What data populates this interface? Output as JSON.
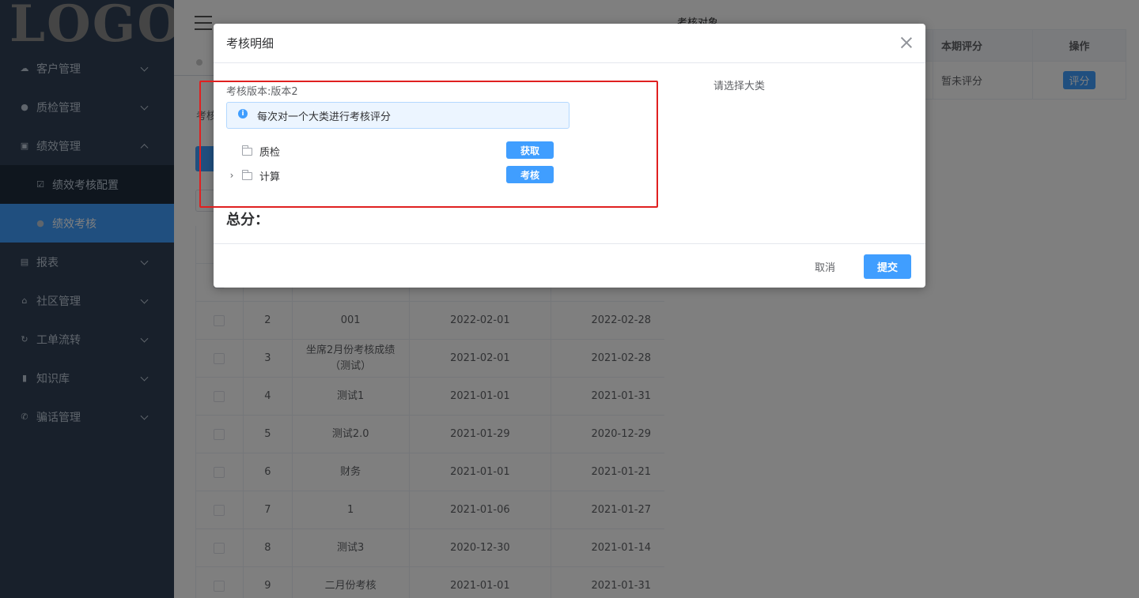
{
  "logo": "LOGO",
  "sidebar": {
    "items": [
      {
        "label": "客户管理",
        "icon": "cloud-icon"
      },
      {
        "label": "质检管理",
        "icon": "circle-icon"
      },
      {
        "label": "绩效管理",
        "icon": "chart-icon",
        "expanded": true,
        "children": [
          {
            "label": "绩效考核配置",
            "icon": "checkbox-icon"
          },
          {
            "label": "绩效考核",
            "icon": "circle-icon",
            "active": true
          }
        ]
      },
      {
        "label": "报表",
        "icon": "report-icon"
      },
      {
        "label": "社区管理",
        "icon": "home-icon"
      },
      {
        "label": "工单流转",
        "icon": "refresh-icon"
      },
      {
        "label": "知识库",
        "icon": "book-icon"
      },
      {
        "label": "骗话管理",
        "icon": "phone-icon"
      }
    ]
  },
  "main": {
    "filter_label": "考核",
    "rows": [
      {
        "index": "2",
        "name": "001",
        "start": "2022-02-01",
        "end": "2022-02-28"
      },
      {
        "index": "3",
        "name": "坐席2月份考核成绩（测试）",
        "start": "2021-02-01",
        "end": "2021-02-28"
      },
      {
        "index": "4",
        "name": "测试1",
        "start": "2021-01-01",
        "end": "2021-01-31"
      },
      {
        "index": "5",
        "name": "测试2.0",
        "start": "2021-01-29",
        "end": "2020-12-29"
      },
      {
        "index": "6",
        "name": "财务",
        "start": "2021-01-01",
        "end": "2021-01-21"
      },
      {
        "index": "7",
        "name": "1",
        "start": "2021-01-06",
        "end": "2021-01-27"
      },
      {
        "index": "8",
        "name": "测试3",
        "start": "2020-12-30",
        "end": "2021-01-14"
      },
      {
        "index": "9",
        "name": "二月份考核",
        "start": "2021-01-01",
        "end": "2021-01-31"
      }
    ]
  },
  "drawer": {
    "title": "考核对象",
    "headers": {
      "score": "本期评分",
      "action": "操作"
    },
    "row": {
      "score": "暂未评分",
      "action": "评分"
    }
  },
  "dialog": {
    "title": "考核明细",
    "version": "考核版本:版本2",
    "alert": "每次对一个大类进行考核评分",
    "tree": [
      {
        "label": "质检",
        "button": "获取",
        "has_children": false
      },
      {
        "label": "计算",
        "button": "考核",
        "has_children": true
      }
    ],
    "total": "总分：",
    "select_hint": "请选择大类",
    "cancel": "取消",
    "submit": "提交"
  },
  "colors": {
    "primary": "#409eff",
    "sidebar_bg": "#304156",
    "highlight": "#e02020"
  }
}
